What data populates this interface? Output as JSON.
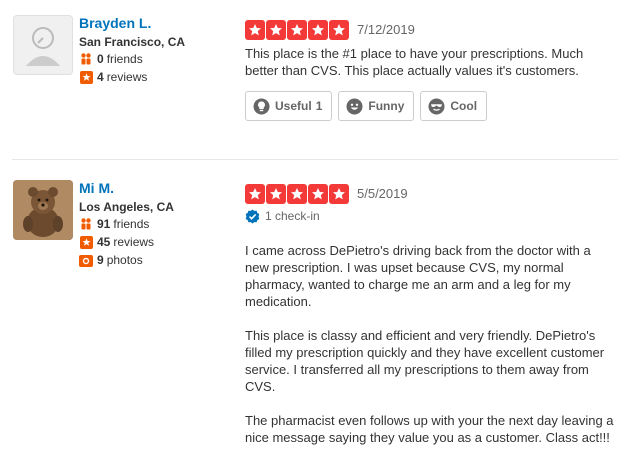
{
  "colors": {
    "link": "#0073bb",
    "star": "#f43939",
    "friends": "#f15c00",
    "badge": "#0073bb"
  },
  "reviews": [
    {
      "user": {
        "name": "Brayden L.",
        "location": "San Francisco, CA",
        "friends": "0",
        "friends_label": "friends",
        "reviews": "4",
        "reviews_label": "reviews"
      },
      "rating": 5,
      "date": "7/12/2019",
      "text": [
        "This place is the #1 place to have your prescriptions. Much better than CVS. This place actually values it's customers."
      ],
      "votes": [
        {
          "label": "Useful",
          "count": "1",
          "icon": "lightbulb-icon"
        },
        {
          "label": "Funny",
          "count": "",
          "icon": "smile-icon"
        },
        {
          "label": "Cool",
          "count": "",
          "icon": "sunglasses-icon"
        }
      ]
    },
    {
      "user": {
        "name": "Mi M.",
        "location": "Los Angeles, CA",
        "friends": "91",
        "friends_label": "friends",
        "reviews": "45",
        "reviews_label": "reviews",
        "photos": "9",
        "photos_label": "photos"
      },
      "rating": 5,
      "date": "5/5/2019",
      "checkin": "1 check-in",
      "text": [
        "I came across DePietro's driving back from the doctor with a new prescription. I was upset because CVS, my normal pharmacy, wanted to charge me an arm and a leg for my medication.",
        "This place is classy and efficient and very friendly. DePietro's filled my prescription quickly and they have excellent customer service. I transferred all my prescriptions to them away from CVS.",
        "The pharmacist even follows up with your the next day leaving a nice message saying they value you as a customer.  Class act!!!"
      ]
    }
  ]
}
